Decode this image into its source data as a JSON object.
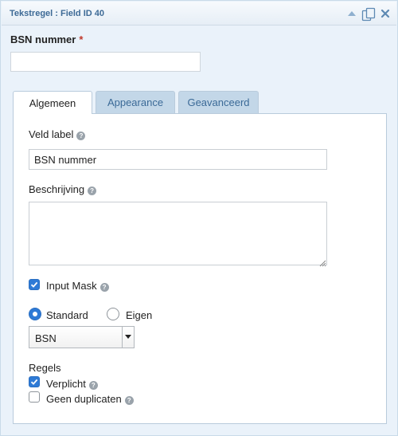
{
  "window": {
    "title": "Tekstregel : Field ID 40"
  },
  "field": {
    "label": "BSN nummer",
    "required_mark": "*",
    "preview_value": ""
  },
  "tabs": [
    {
      "label": "Algemeen",
      "active": true
    },
    {
      "label": "Appearance",
      "active": false
    },
    {
      "label": "Geavanceerd",
      "active": false
    }
  ],
  "general": {
    "field_label_title": "Veld label",
    "field_label_value": "BSN nummer",
    "description_title": "Beschrijving",
    "description_value": "",
    "input_mask_label": "Input Mask",
    "input_mask_checked": true,
    "mask_type_standard": "Standard",
    "mask_type_custom": "Eigen",
    "mask_type_selected": "Standard",
    "mask_select_value": "BSN",
    "rules_title": "Regels",
    "rule_required": "Verplicht",
    "rule_required_checked": true,
    "rule_no_duplicates": "Geen duplicaten",
    "rule_no_duplicates_checked": false
  },
  "icons": {
    "help": "?",
    "collapse": "triangle-up-icon",
    "duplicate": "duplicate-icon",
    "delete": "close-icon"
  },
  "colors": {
    "accent": "#2e7ad6",
    "title_text": "#3d6a96",
    "tab_inactive_bg": "#c3d7e8",
    "required": "#c0392b"
  }
}
